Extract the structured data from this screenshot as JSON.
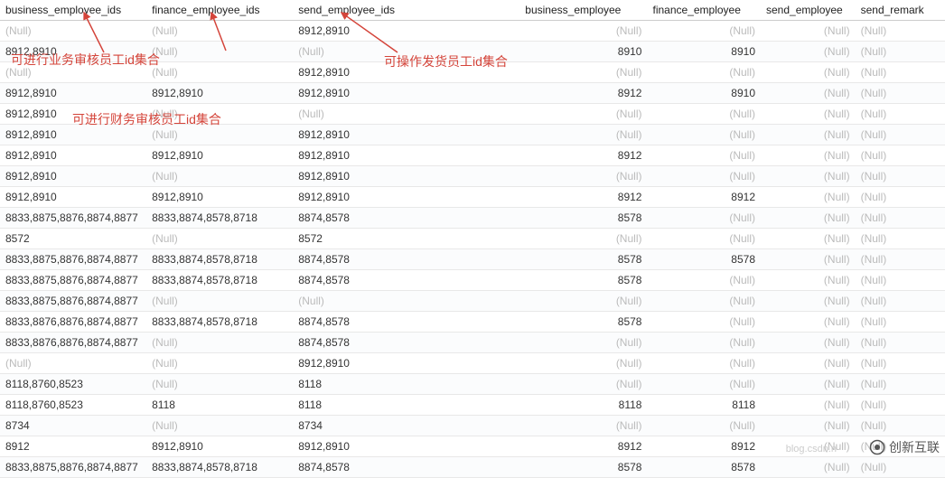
{
  "columns": [
    {
      "key": "business_employee_ids",
      "label": "business_employee_ids",
      "align": "left",
      "cls": "col-biz-ids"
    },
    {
      "key": "finance_employee_ids",
      "label": "finance_employee_ids",
      "align": "left",
      "cls": "col-fin-ids"
    },
    {
      "key": "send_employee_ids",
      "label": "send_employee_ids",
      "align": "left",
      "cls": "col-send-ids"
    },
    {
      "key": "business_employee",
      "label": "business_employee",
      "align": "right",
      "cls": "col-biz"
    },
    {
      "key": "finance_employee",
      "label": "finance_employee",
      "align": "right",
      "cls": "col-fin"
    },
    {
      "key": "send_employee",
      "label": "send_employee",
      "align": "right",
      "cls": "col-send"
    },
    {
      "key": "send_remark",
      "label": "send_remark",
      "align": "left",
      "cls": "col-remark"
    }
  ],
  "null_text": "(Null)",
  "rows": [
    {
      "business_employee_ids": null,
      "finance_employee_ids": null,
      "send_employee_ids": "8912,8910",
      "business_employee": null,
      "finance_employee": null,
      "send_employee": null,
      "send_remark": null
    },
    {
      "business_employee_ids": "8912,8910",
      "finance_employee_ids": null,
      "send_employee_ids": null,
      "business_employee": "8910",
      "finance_employee": "8910",
      "send_employee": null,
      "send_remark": null
    },
    {
      "business_employee_ids": null,
      "finance_employee_ids": null,
      "send_employee_ids": "8912,8910",
      "business_employee": null,
      "finance_employee": null,
      "send_employee": null,
      "send_remark": null
    },
    {
      "business_employee_ids": "8912,8910",
      "finance_employee_ids": "8912,8910",
      "send_employee_ids": "8912,8910",
      "business_employee": "8912",
      "finance_employee": "8910",
      "send_employee": null,
      "send_remark": null
    },
    {
      "business_employee_ids": "8912,8910",
      "finance_employee_ids": null,
      "send_employee_ids": null,
      "business_employee": null,
      "finance_employee": null,
      "send_employee": null,
      "send_remark": null
    },
    {
      "business_employee_ids": "8912,8910",
      "finance_employee_ids": null,
      "send_employee_ids": "8912,8910",
      "business_employee": null,
      "finance_employee": null,
      "send_employee": null,
      "send_remark": null
    },
    {
      "business_employee_ids": "8912,8910",
      "finance_employee_ids": "8912,8910",
      "send_employee_ids": "8912,8910",
      "business_employee": "8912",
      "finance_employee": null,
      "send_employee": null,
      "send_remark": null
    },
    {
      "business_employee_ids": "8912,8910",
      "finance_employee_ids": null,
      "send_employee_ids": "8912,8910",
      "business_employee": null,
      "finance_employee": null,
      "send_employee": null,
      "send_remark": null
    },
    {
      "business_employee_ids": "8912,8910",
      "finance_employee_ids": "8912,8910",
      "send_employee_ids": "8912,8910",
      "business_employee": "8912",
      "finance_employee": "8912",
      "send_employee": null,
      "send_remark": null
    },
    {
      "business_employee_ids": "8833,8875,8876,8874,8877",
      "finance_employee_ids": "8833,8874,8578,8718",
      "send_employee_ids": "8874,8578",
      "business_employee": "8578",
      "finance_employee": null,
      "send_employee": null,
      "send_remark": null
    },
    {
      "business_employee_ids": "8572",
      "finance_employee_ids": null,
      "send_employee_ids": "8572",
      "business_employee": null,
      "finance_employee": null,
      "send_employee": null,
      "send_remark": null
    },
    {
      "business_employee_ids": "8833,8875,8876,8874,8877",
      "finance_employee_ids": "8833,8874,8578,8718",
      "send_employee_ids": "8874,8578",
      "business_employee": "8578",
      "finance_employee": "8578",
      "send_employee": null,
      "send_remark": null
    },
    {
      "business_employee_ids": "8833,8875,8876,8874,8877",
      "finance_employee_ids": "8833,8874,8578,8718",
      "send_employee_ids": "8874,8578",
      "business_employee": "8578",
      "finance_employee": null,
      "send_employee": null,
      "send_remark": null
    },
    {
      "business_employee_ids": "8833,8875,8876,8874,8877",
      "finance_employee_ids": null,
      "send_employee_ids": null,
      "business_employee": null,
      "finance_employee": null,
      "send_employee": null,
      "send_remark": null
    },
    {
      "business_employee_ids": "8833,8876,8876,8874,8877",
      "finance_employee_ids": "8833,8874,8578,8718",
      "send_employee_ids": "8874,8578",
      "business_employee": "8578",
      "finance_employee": null,
      "send_employee": null,
      "send_remark": null
    },
    {
      "business_employee_ids": "8833,8876,8876,8874,8877",
      "finance_employee_ids": null,
      "send_employee_ids": "8874,8578",
      "business_employee": null,
      "finance_employee": null,
      "send_employee": null,
      "send_remark": null
    },
    {
      "business_employee_ids": null,
      "finance_employee_ids": null,
      "send_employee_ids": "8912,8910",
      "business_employee": null,
      "finance_employee": null,
      "send_employee": null,
      "send_remark": null
    },
    {
      "business_employee_ids": "8118,8760,8523",
      "finance_employee_ids": null,
      "send_employee_ids": "8118",
      "business_employee": null,
      "finance_employee": null,
      "send_employee": null,
      "send_remark": null
    },
    {
      "business_employee_ids": "8118,8760,8523",
      "finance_employee_ids": "8118",
      "send_employee_ids": "8118",
      "business_employee": "8118",
      "finance_employee": "8118",
      "send_employee": null,
      "send_remark": null
    },
    {
      "business_employee_ids": "8734",
      "finance_employee_ids": null,
      "send_employee_ids": "8734",
      "business_employee": null,
      "finance_employee": null,
      "send_employee": null,
      "send_remark": null
    },
    {
      "business_employee_ids": "8912",
      "finance_employee_ids": "8912,8910",
      "send_employee_ids": "8912,8910",
      "business_employee": "8912",
      "finance_employee": "8912",
      "send_employee": null,
      "send_remark": null
    },
    {
      "business_employee_ids": "8833,8875,8876,8874,8877",
      "finance_employee_ids": "8833,8874,8578,8718",
      "send_employee_ids": "8874,8578",
      "business_employee": "8578",
      "finance_employee": "8578",
      "send_employee": null,
      "send_remark": null
    }
  ],
  "annotations": {
    "a1": "可进行业务审核员工id集合",
    "a2": "可进行财务审核员工id集合",
    "a3": "可操作发货员工id集合"
  },
  "watermark": {
    "text": "创新互联",
    "faded_url": "blog.csdn.n"
  }
}
